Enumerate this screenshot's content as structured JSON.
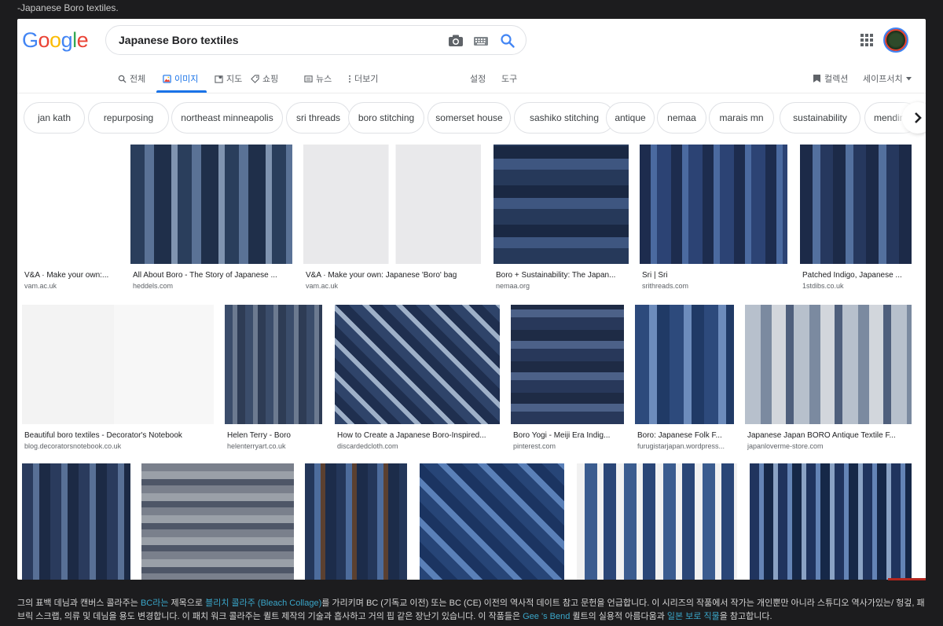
{
  "top_caption": "-Japanese Boro textiles.",
  "search": {
    "query": "Japanese Boro textiles"
  },
  "logo_letters": [
    {
      "ch": "G",
      "color": "#4285f4"
    },
    {
      "ch": "o",
      "color": "#ea4335"
    },
    {
      "ch": "o",
      "color": "#fbbc05"
    },
    {
      "ch": "g",
      "color": "#4285f4"
    },
    {
      "ch": "l",
      "color": "#34a853"
    },
    {
      "ch": "e",
      "color": "#ea4335"
    }
  ],
  "nav": {
    "all": "전체",
    "images": "이미지",
    "maps": "지도",
    "shopping": "쇼핑",
    "news": "뉴스",
    "more": "더보기",
    "settings": "설정",
    "tools": "도구",
    "collections": "컬렉션",
    "safesearch": "세이프서치"
  },
  "chips": [
    "jan kath",
    "repurposing",
    "northeast minneapolis",
    "sri threads",
    "boro stitching",
    "somerset house",
    "sashiko stitching",
    "antique",
    "nemaa",
    "marais mn",
    "sustainability",
    "mending"
  ],
  "results": [
    {
      "title": "V&A · Make your own:...",
      "site": "vam.ac.uk"
    },
    {
      "title": "All About Boro - The Story of Japanese ...",
      "site": "heddels.com"
    },
    {
      "title": "V&A · Make your own: Japanese 'Boro' bag",
      "site": "vam.ac.uk"
    },
    {
      "title": "Boro + Sustainability: The Japan...",
      "site": "nemaa.org"
    },
    {
      "title": "Sri | Sri",
      "site": "srithreads.com"
    },
    {
      "title": "Patched Indigo, Japanese ...",
      "site": "1stdibs.co.uk"
    },
    {
      "title": "Beautiful boro textiles - Decorator's Notebook",
      "site": "blog.decoratorsnotebook.co.uk"
    },
    {
      "title": "Helen Terry - Boro",
      "site": "helenterryart.co.uk"
    },
    {
      "title": "How to Create a Japanese Boro-Inspired...",
      "site": "discardedcloth.com"
    },
    {
      "title": "Boro Yogi - Meiji Era Indig...",
      "site": "pinterest.com"
    },
    {
      "title": "Boro: Japanese Folk F...",
      "site": "furugistarjapan.wordpress..."
    },
    {
      "title": "Japanese Japan BORO Antique Textile F...",
      "site": "japanloverme-store.com"
    }
  ],
  "bottom": {
    "p1": "그의 표백 데님과 캔버스 콜라주는 ",
    "l1": "BC라는",
    "p2": " 제목으로 ",
    "l2": "블리치 콜라주 (Bleach Collage)",
    "p3": "를 가리키며 BC (기독교 이전) 또는 BC (CE) 이전의 역사적 데이트 참고 문헌을 언급합니다. 이 시리즈의 작품에서 작가는 개인뿐만 아니라 스튜디오 역사가있는/ 헝겊, 패브릭 스크랩, 의류 및 데님을 용도 변경합니다. 이 패치 워크 콜라주는 퀼트 제작의 기술과 흡사하고 거의 핍 같은 장난기 있습니다. 이 작품들은 ",
    "l3": "Gee 's Bend",
    "p4": " 퀼트의 실용적 아름다움과 ",
    "l4": "일본 보로 직물",
    "p5": "을 참고합니다."
  }
}
